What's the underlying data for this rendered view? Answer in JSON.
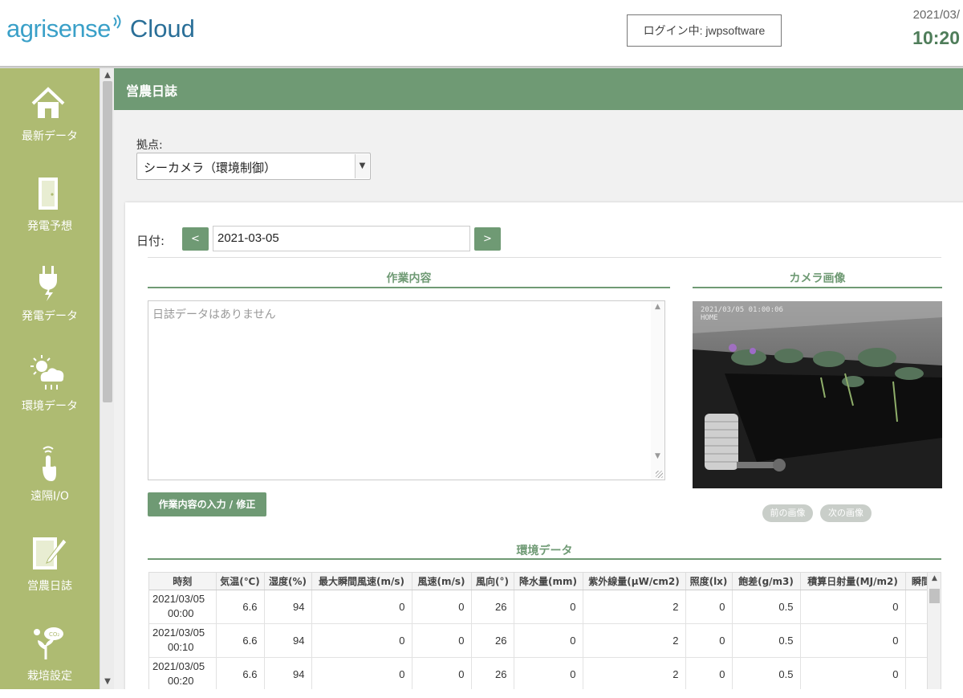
{
  "header": {
    "logo_prefix": "agrisense",
    "logo_suffix": "Cloud",
    "login_text": "ログイン中: jwpsoftware",
    "date": "2021/03/",
    "time": "10:20"
  },
  "colors": {
    "accent": "#6f9a74",
    "sidebar": "#aebb72",
    "logo_blue": "#3aa0c8"
  },
  "sidebar": {
    "items": [
      {
        "label": "最新データ",
        "icon": "home-icon"
      },
      {
        "label": "発電予想",
        "icon": "door-icon"
      },
      {
        "label": "発電データ",
        "icon": "plug-bolt-icon"
      },
      {
        "label": "環境データ",
        "icon": "weather-icon"
      },
      {
        "label": "遠隔I/O",
        "icon": "remote-touch-icon"
      },
      {
        "label": "営農日誌",
        "icon": "notebook-pen-icon"
      },
      {
        "label": "栽培設定",
        "icon": "plant-co2-icon"
      }
    ]
  },
  "page": {
    "title": "営農日誌",
    "base_label": "拠点:",
    "base_value": "シーカメラ（環境制御）",
    "date_label": "日付:",
    "prev_label": "<",
    "next_label": ">",
    "date_value": "2021-03-05"
  },
  "work": {
    "title": "作業内容",
    "placeholder": "日誌データはありません",
    "edit_button": "作業内容の入力 / 修正"
  },
  "camera": {
    "title": "カメラ画像",
    "timestamp": "2021/03/05  01:00:06",
    "location": "HOME",
    "prev_button": "前の画像",
    "next_button": "次の画像"
  },
  "env": {
    "title": "環境データ",
    "columns": [
      "時刻",
      "気温(℃)",
      "湿度(%)",
      "最大瞬間風速(m/s)",
      "風速(m/s)",
      "風向(°)",
      "降水量(mm)",
      "紫外線量(μW/cm2)",
      "照度(lx)",
      "飽差(g/m3)",
      "積算日射量(MJ/m2)",
      "瞬間"
    ],
    "rows": [
      [
        "2021/03/05",
        "00:00",
        "6.6",
        "94",
        "0",
        "0",
        "26",
        "0",
        "2",
        "0",
        "0.5",
        "0"
      ],
      [
        "2021/03/05",
        "00:10",
        "6.6",
        "94",
        "0",
        "0",
        "26",
        "0",
        "2",
        "0",
        "0.5",
        "0"
      ],
      [
        "2021/03/05",
        "00:20",
        "6.6",
        "94",
        "0",
        "0",
        "26",
        "0",
        "2",
        "0",
        "0.5",
        "0"
      ]
    ]
  }
}
